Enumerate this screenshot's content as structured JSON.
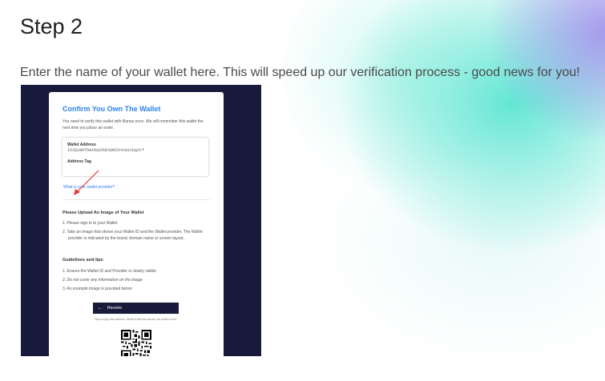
{
  "heading": "Step 2",
  "instruction": "Enter the name of your wallet here. This will speed up our verification process - good news for you!",
  "screenshot": {
    "card_title": "Confirm You Own The Wallet",
    "card_description": "You need to verify this wallet with Banxa once. We will remember this wallet the next time you place an order.",
    "wallet_address_label": "Wallet Address",
    "wallet_address_value": "163Q1WN7bm1Nq1RqhXWGCb4im1oUg3rf",
    "address_tag_label": "Address Tag",
    "provider_link": "What is your wallet provider?",
    "upload_title": "Please Upload An Image of Your Wallet",
    "upload_steps": [
      "1. Please sign in to your Wallet",
      "2. Take an image that shows your Wallet ID and the Wallet provider. The Wallet provider is indicated by the brand, domain name or screen layout."
    ],
    "guidelines_title": "Guidelines and tips",
    "guidelines": [
      "1. Ensure the Wallet ID and Provider is clearly visible",
      "2. Do not cover any information on the image",
      "3. An example image is provided below"
    ],
    "receive_label": "Receive",
    "tap_note": "Tap to copy this address. Share it with the sender via email or text.",
    "annotation_color": "#e53935"
  }
}
